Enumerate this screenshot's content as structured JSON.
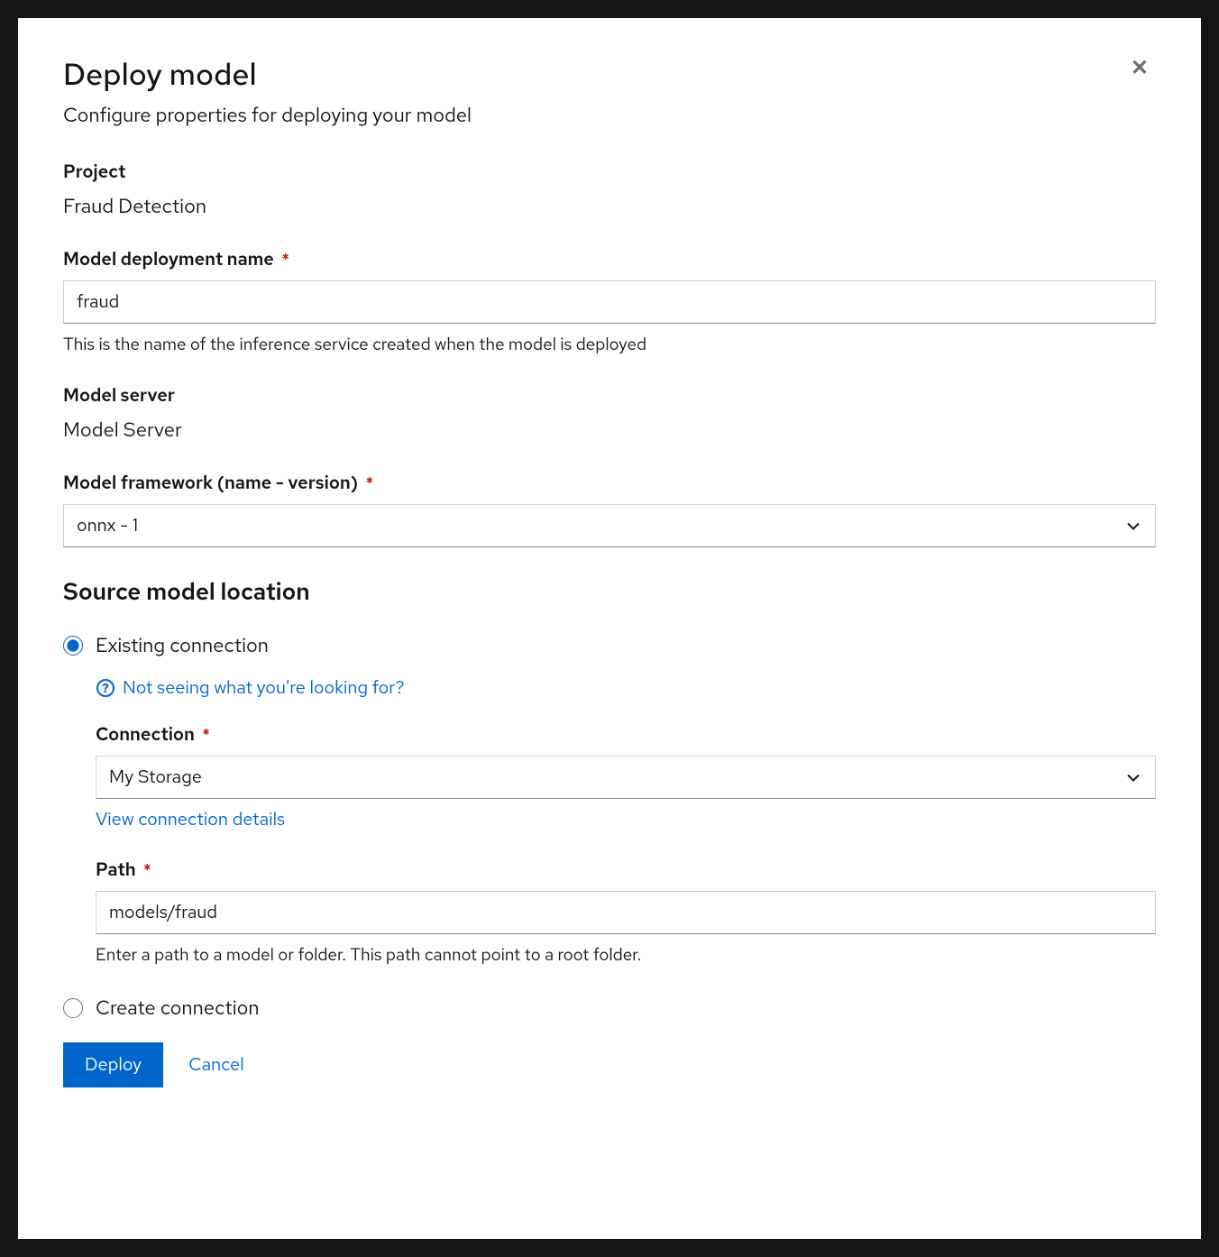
{
  "modal": {
    "title": "Deploy model",
    "subtitle": "Configure properties for deploying your model"
  },
  "project": {
    "label": "Project",
    "value": "Fraud Detection"
  },
  "deploymentName": {
    "label": "Model deployment name",
    "value": "fraud",
    "help": "This is the name of the inference service created when the model is deployed"
  },
  "modelServer": {
    "label": "Model server",
    "value": "Model Server"
  },
  "framework": {
    "label": "Model framework (name - version)",
    "value": "onnx - 1"
  },
  "sourceLocation": {
    "title": "Source model location",
    "options": {
      "existing": "Existing connection",
      "create": "Create connection"
    },
    "helpLink": "Not seeing what you're looking for?",
    "connection": {
      "label": "Connection",
      "value": "My Storage",
      "detailsLink": "View connection details"
    },
    "path": {
      "label": "Path",
      "value": "models/fraud",
      "help": "Enter a path to a model or folder. This path cannot point to a root folder."
    }
  },
  "actions": {
    "deploy": "Deploy",
    "cancel": "Cancel"
  }
}
